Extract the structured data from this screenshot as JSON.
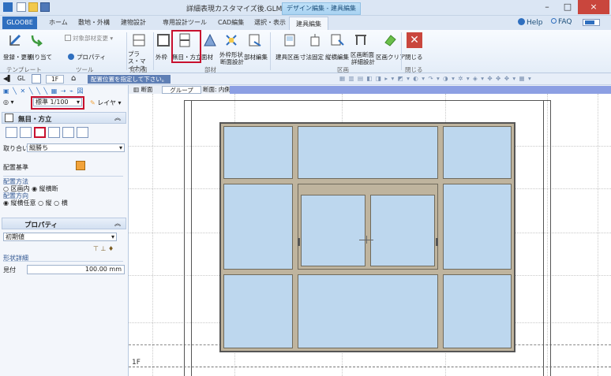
{
  "titlebar": {
    "title": "詳細表現カスタマイズ後.GLM - GLOOBE",
    "context_tab": "デザイン編集 - 建具編集",
    "minimize": "–",
    "maximize": "□",
    "close": "×"
  },
  "tabs": {
    "app": "GLOOBE",
    "items": [
      "ホーム",
      "敷地・外構",
      "建物設計",
      "専用設計ツール",
      "CAD編集",
      "選択・表示",
      "建具編集"
    ],
    "help": "Help",
    "faq": "FAQ"
  },
  "ribbon": {
    "template": {
      "register": "登録・更新",
      "assign": "割り当て",
      "target_change": "対象部材変更",
      "property": "プロパティ",
      "group": "テンプレート"
    },
    "tool": {
      "group": "ツール"
    },
    "view": {
      "plus_minus": "プラス・マイナス",
      "group": "見付面"
    },
    "parts": {
      "outer_frame": "外枠",
      "frame_stile": "無目・方立",
      "inner_panel": "面材",
      "outer_shape": "外枠形状",
      "section_design": "断面設計",
      "part_edit": "部材編集",
      "group": "部材"
    },
    "division": {
      "fitting_division": "建具区画",
      "dimension_fix": "寸法固定",
      "longitudinal_edit": "縦横編集",
      "section_detail": "区画断面",
      "detail_design": "詳細設計",
      "division_clear": "区画クリア",
      "group": "区画"
    },
    "close": {
      "label": "閉じる",
      "group": "閉じる"
    }
  },
  "toolbar2": {
    "floor": "1F",
    "message": "配置位置を指定して下さい。"
  },
  "leftpanel": {
    "scale": "標準 1/100",
    "layer": "レイヤ",
    "section_title": "無目・方立",
    "fit_label": "取り合い",
    "fit_value": "縦勝ち",
    "placement_base": "配置基準",
    "placement_method": "配置方法",
    "method_options": [
      "区画内",
      "縦横断"
    ],
    "direction": "配置方向",
    "direction_options": [
      "縦横任意",
      "縦",
      "横"
    ],
    "property_title": "プロパティ",
    "initial_value": "初期値",
    "shape_detail": "形状詳細",
    "visible_label": "見付",
    "visible_value": "100.00 mm"
  },
  "viewtabs": {
    "section": "断面",
    "group": "グループ",
    "section_inner": "断面: 内側"
  },
  "canvas": {
    "floor_label": "1F"
  },
  "colors": {
    "accent": "#2f6fbf",
    "highlight": "#c8102e",
    "glass": "#bdd7ee",
    "frame": "#bfb49e"
  }
}
